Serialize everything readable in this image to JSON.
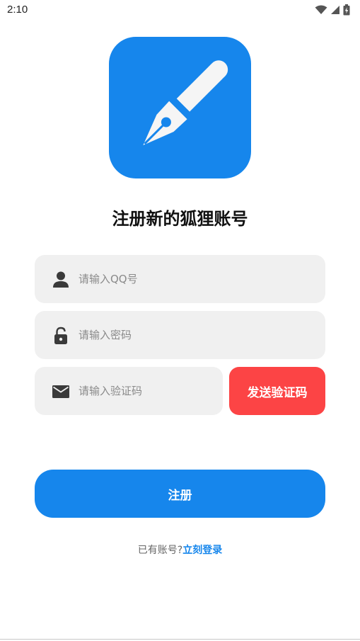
{
  "status_bar": {
    "time": "2:10",
    "icons": [
      "wifi-icon",
      "cellular-signal-icon",
      "battery-charging-icon"
    ]
  },
  "logo": {
    "icon": "fountain-pen-icon",
    "color": "#1686ec"
  },
  "title": "注册新的狐狸账号",
  "form": {
    "qq_field": {
      "icon": "user-icon",
      "placeholder": "请输入QQ号",
      "value": ""
    },
    "password_field": {
      "icon": "lock-icon",
      "placeholder": "请输入密码",
      "value": ""
    },
    "code_field": {
      "icon": "mail-icon",
      "placeholder": "请输入验证码",
      "value": ""
    },
    "send_code_label": "发送验证码",
    "register_label": "注册"
  },
  "login_prompt": {
    "text": "已有账号?",
    "link": "立刻登录"
  },
  "colors": {
    "primary": "#1686ec",
    "danger": "#fc4445",
    "field_bg": "#f0f0f0"
  }
}
